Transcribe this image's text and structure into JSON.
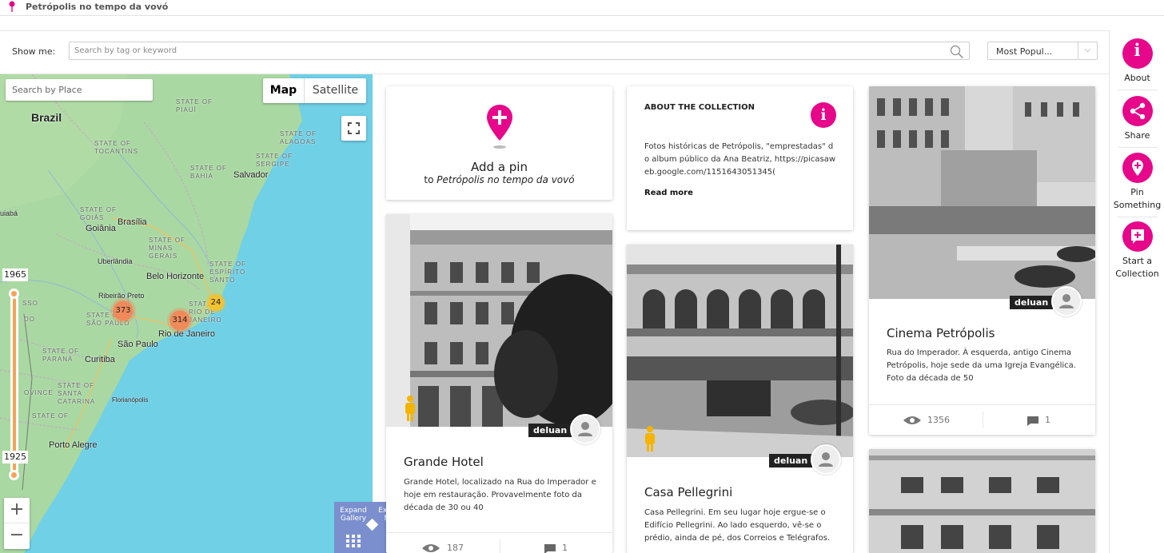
{
  "app": {
    "title": "Petrópolis no tempo da vovó"
  },
  "toolbar": {
    "show_me_label": "Show me:",
    "search_placeholder": "Search by tag or keyword",
    "sort_value": "Most Popul..."
  },
  "map": {
    "place_placeholder": "Search by Place",
    "map_type_map": "Map",
    "map_type_satellite": "Satellite",
    "labels": {
      "brazil": "Brazil",
      "piaui": "STATE OF PIAUÍ",
      "alagoas": "STATE OF ALAGOAS",
      "tocantins": "STATE OF TOCANTINS",
      "sergipe": "STATE OF SERGIPE",
      "bahia": "STATE OF BAHIA",
      "salvador": "Salvador",
      "goias": "STATE OF GOIÁS",
      "brasilia": "Brasília",
      "goiania": "Goiânia",
      "minas": "STATE OF MINAS GERAIS",
      "espirito": "STATE OF ESPÍRITO SANTO",
      "uberlandia": "Uberlândia",
      "belo": "Belo Horizonte",
      "ribeirao": "Ribeirão Preto",
      "sp_state": "STATE OF SÃO PAULO",
      "rj_state": "STATE OF RIO DE JANEIRO",
      "rio": "Rio de Janeiro",
      "saopaulo": "São Paulo",
      "parana": "STATE OF PARANÁ",
      "curitiba": "Curitiba",
      "santa": "STATE OF SANTA CATARINA",
      "floripa": "Florianópolis",
      "rs": "STATE OF",
      "porto": "Porto Alegre",
      "uiaba": "uiabá",
      "sso": "SSO",
      "do": "DO",
      "ovince": "OVINCE"
    },
    "clusters": {
      "c1": "373",
      "c2": "314",
      "c3": "24"
    },
    "year_top": "1965",
    "year_bottom": "1925",
    "zoom_in": "+",
    "zoom_out": "−",
    "expand_gallery": "Expand Gallery",
    "expand_map": "Expand Map"
  },
  "cards": {
    "add_pin": {
      "title": "Add a pin",
      "subtitle_prefix": "to ",
      "subtitle_name": "Petrópolis no tempo da vovó"
    },
    "about": {
      "heading": "ABOUT THE COLLECTION",
      "text": "Fotos históricas de Petrópolis, \"emprestadas\" do album público da Ana Beatriz, https://picasaweb.google.com/1151643051345(",
      "read_more": "Read more"
    },
    "grande": {
      "title": "Grande Hotel",
      "desc": "Grande Hotel, localizado na Rua do Imperador e hoje em restauração. Provavelmente foto da década de 30 ou 40",
      "user": "deluan",
      "views": "187",
      "comments": "1"
    },
    "pellegrini": {
      "title": "Casa Pellegrini",
      "desc": "Casa Pellegrini. Em seu lugar hoje ergue-se o Edifício Pellegrini. Ao lado esquerdo, vê-se o prédio, ainda de pé, dos Correios e Telégrafos.",
      "user": "deluan"
    },
    "cinema": {
      "title": "Cinema Petrópolis",
      "desc": "Rua do Imperador. À esquerda, antigo Cinema Petrópolis, hoje sede da uma Igreja Evangélica. Foto da década de 50",
      "user": "deluan",
      "views": "1356",
      "comments": "1"
    }
  },
  "sidebar": {
    "about": "About",
    "share": "Share",
    "pin": "Pin Something",
    "collection": "Start a Collection"
  },
  "colors": {
    "accent": "#e6078a",
    "slider": "#f5a457",
    "expand": "#7b8fce"
  }
}
